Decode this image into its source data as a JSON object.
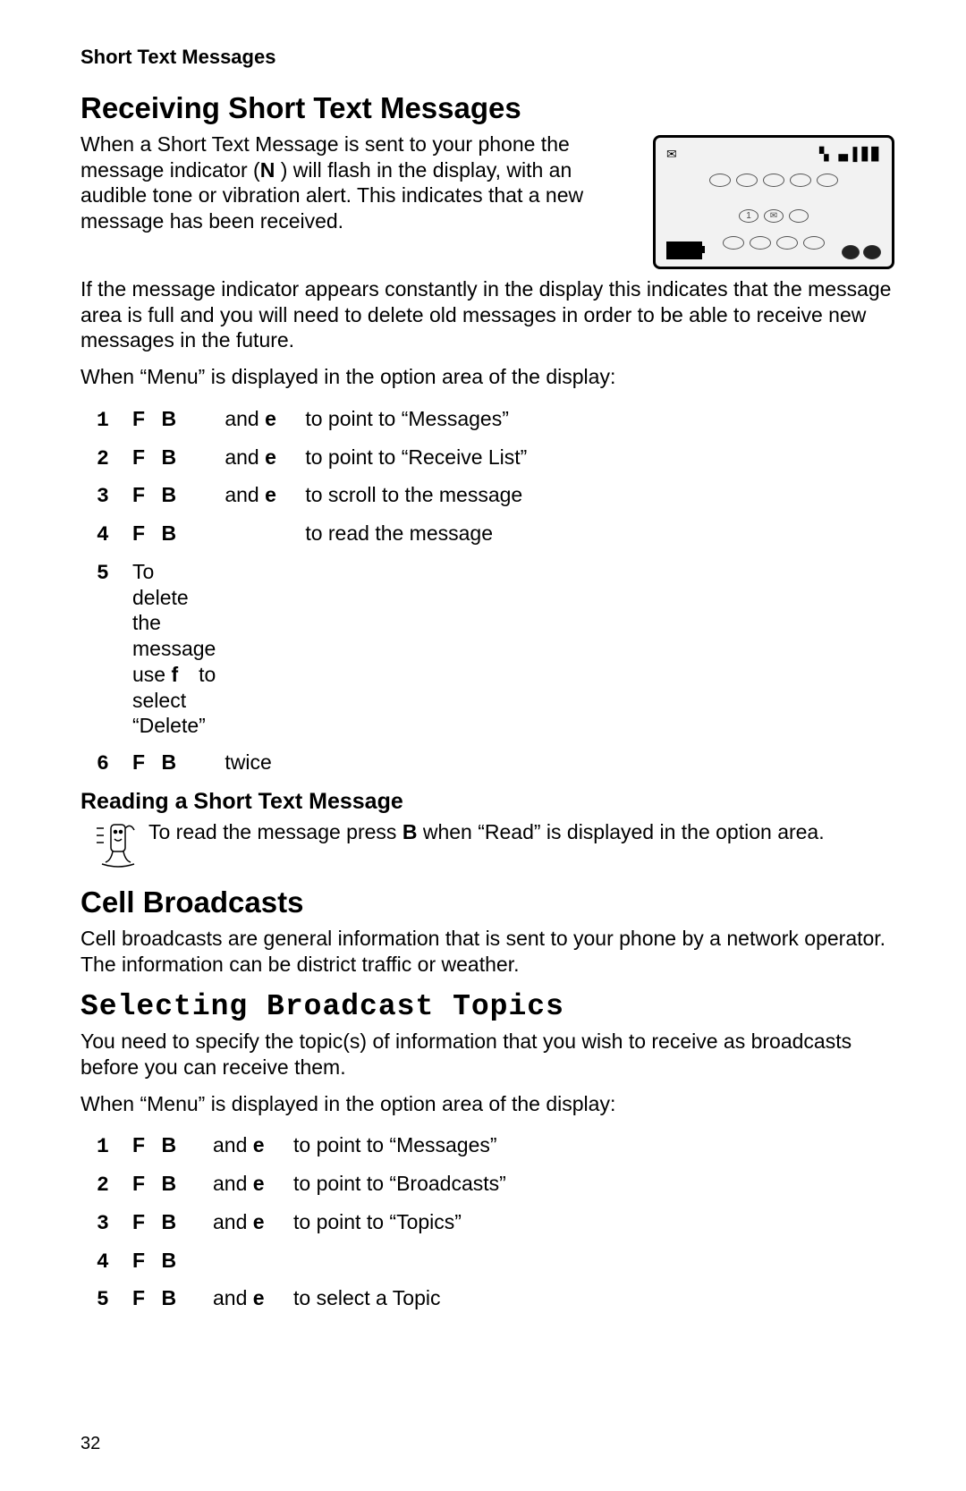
{
  "chapter": "Short Text Messages",
  "section1": {
    "heading": "Receiving Short Text Messages",
    "para1_prefix": "When a Short Text Message is sent to your phone the message indicator (",
    "para1_icon": "N",
    "para1_suffix": " ) will flash in the display, with an audible tone or vibration alert. This indicates that a new message has been received.",
    "para2": "If the message indicator appears constantly in the display this indicates that the message area is full and you will need to delete old messages in order to be able to receive new messages in the future.",
    "lead": "When “Menu” is displayed in the option area of the display:",
    "steps": [
      {
        "n": "1",
        "keys": "F B",
        "mid": "and e",
        "desc": "to point to “Messages”"
      },
      {
        "n": "2",
        "keys": "F B",
        "mid": "and e",
        "desc": "to point to “Receive List”"
      },
      {
        "n": "3",
        "keys": "F B",
        "mid": "and e",
        "desc": "to scroll to the message"
      },
      {
        "n": "4",
        "keys": "F B",
        "mid": "",
        "desc": "to read the message"
      },
      {
        "n": "5",
        "full": "To delete the message use f to select “Delete”"
      },
      {
        "n": "6",
        "keys": "F B",
        "mid": "twice",
        "desc": ""
      }
    ]
  },
  "reading": {
    "heading": "Reading a Short Text Message",
    "tip_pre": "To read the message press ",
    "tip_key": "B",
    "tip_post": " when “Read” is displayed in the option area."
  },
  "section2": {
    "heading": "Cell Broadcasts",
    "para": "Cell broadcasts are general information that is sent to your phone by a network operator. The information can be district traffic or weather."
  },
  "selecting": {
    "heading": "Selecting Broadcast Topics",
    "para": "You need to specify the topic(s) of information that you wish to receive as broadcasts before you can receive them.",
    "lead": "When “Menu” is displayed in the option area of the display:",
    "steps": [
      {
        "n": "1",
        "keys": "F B",
        "mid": "and e",
        "desc": "to point to “Messages”"
      },
      {
        "n": "2",
        "keys": "F B",
        "mid": "and e",
        "desc": "to point to “Broadcasts”"
      },
      {
        "n": "3",
        "keys": "F B",
        "mid": "and e",
        "desc": "to point to “Topics”"
      },
      {
        "n": "4",
        "keys": "F B",
        "mid": "",
        "desc": ""
      },
      {
        "n": "5",
        "keys": "F B",
        "mid": "and e",
        "desc": "to select a Topic"
      }
    ]
  },
  "phone_figure": {
    "row2_badge": "1"
  },
  "page_number": "32"
}
